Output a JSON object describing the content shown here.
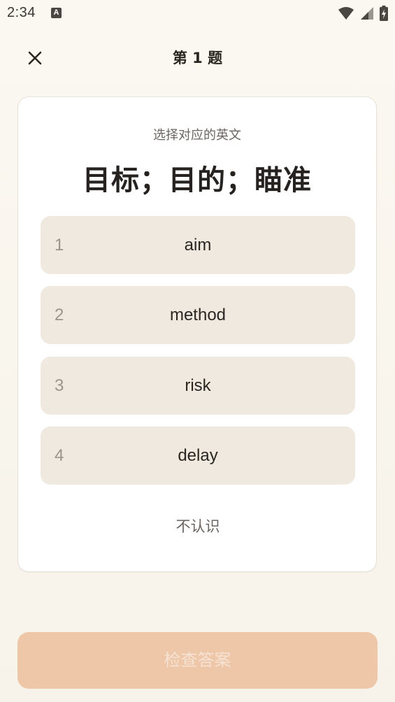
{
  "status_bar": {
    "time": "2:34",
    "notification_icon_letter": "A",
    "icons": [
      "wifi-icon",
      "signal-icon",
      "battery-charging-icon"
    ]
  },
  "header": {
    "title": "第 1 题",
    "close_icon": "close-icon"
  },
  "question": {
    "prompt": "选择对应的英文",
    "word": "目标；目的；瞄准"
  },
  "options": [
    {
      "number": "1",
      "text": "aim"
    },
    {
      "number": "2",
      "text": "method"
    },
    {
      "number": "3",
      "text": "risk"
    },
    {
      "number": "4",
      "text": "delay"
    }
  ],
  "unknown_label": "不认识",
  "check_button_label": "检查答案",
  "colors": {
    "background": "#f8f4ec",
    "card": "#ffffff",
    "option_bg": "#efe9df",
    "check_button_bg": "#eec6a8",
    "check_button_text": "#f6e2d3"
  }
}
